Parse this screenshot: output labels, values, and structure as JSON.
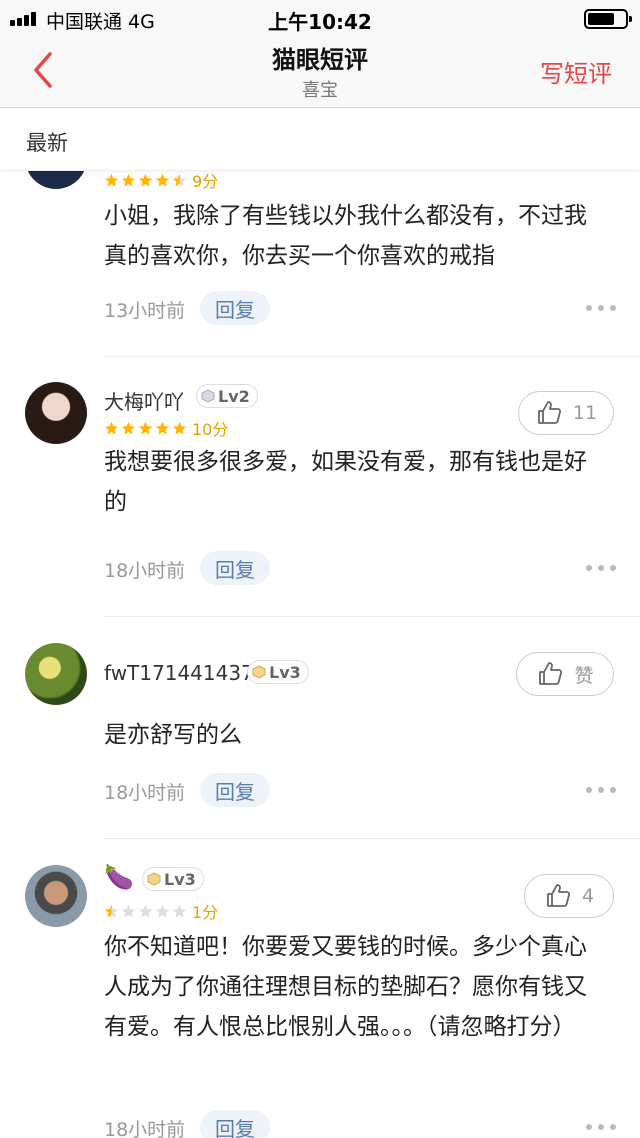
{
  "status_bar": {
    "carrier": "中国联通   4G",
    "time": "上午10:42"
  },
  "nav": {
    "title": "猫眼短评",
    "subtitle": "喜宝",
    "action": "写短评"
  },
  "sort": {
    "label": "最新"
  },
  "reviews": [
    {
      "username": "",
      "level": "",
      "score": "9分",
      "stars": 4.5,
      "likes": "",
      "content": "小姐，我除了有些钱以外我什么都没有，不过我真的喜欢你，你去买一个你喜欢的戒指",
      "time": "13小时前",
      "reply_label": "回复"
    },
    {
      "username": "大梅吖吖",
      "level": "Lv2",
      "score": "10分",
      "stars": 5,
      "likes": "11",
      "content": "我想要很多很多爱，如果没有爱，那有钱也是好的",
      "time": "18小时前",
      "reply_label": "回复"
    },
    {
      "username": "fwT171441437",
      "level": "Lv3",
      "score": "",
      "stars": 0,
      "likes": "赞",
      "content": "是亦舒写的么",
      "time": "18小时前",
      "reply_label": "回复"
    },
    {
      "username": "🍆",
      "level": "Lv3",
      "score": "1分",
      "stars": 0.5,
      "likes": "4",
      "content": "你不知道吧！你要爱又要钱的时候。多少个真心人成为了你通往理想目标的垫脚石？愿你有钱又有爱。有人恨总比恨别人强。。。（请忽略打分）",
      "time": "18小时前",
      "reply_label": "回复"
    }
  ],
  "colors": {
    "accent": "#e54545",
    "star": "#ffb400",
    "star_empty": "#dddddd",
    "reply_bg": "#eef2f9",
    "reply_text": "#5a7db0"
  }
}
